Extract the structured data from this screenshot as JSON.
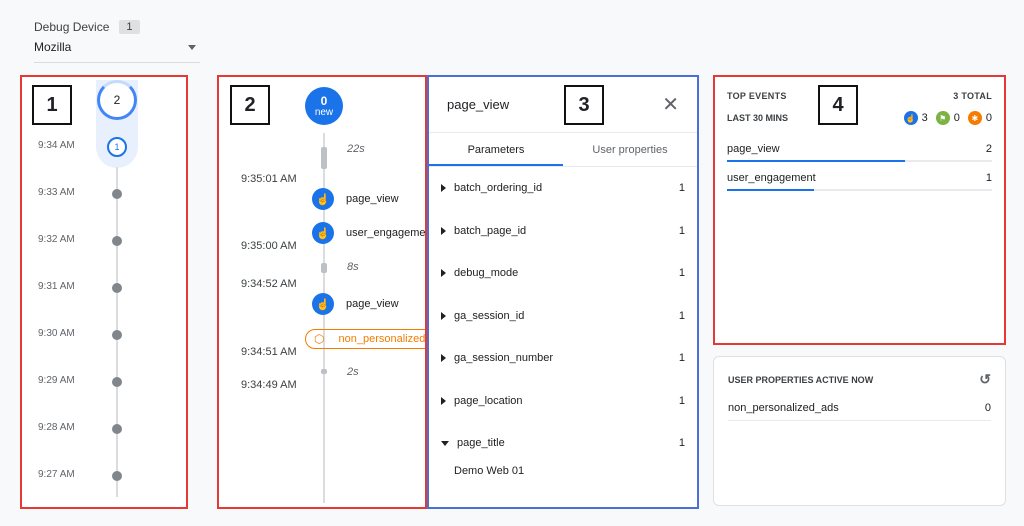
{
  "debug_device": {
    "label": "Debug Device",
    "count": "1",
    "selected": "Mozilla"
  },
  "badges": {
    "b1": "1",
    "b2": "2",
    "b3": "3",
    "b4": "4"
  },
  "minutes_panel": {
    "top_count": "2",
    "current_count": "1",
    "times": [
      "9:34 AM",
      "9:33 AM",
      "9:32 AM",
      "9:31 AM",
      "9:30 AM",
      "9:29 AM",
      "9:28 AM",
      "9:27 AM"
    ]
  },
  "seconds_panel": {
    "new_count": "0",
    "new_label": "new",
    "gaps": [
      "22s",
      "8s",
      "2s"
    ],
    "times": [
      "9:35:01 AM",
      "9:35:00 AM",
      "9:34:52 AM",
      "9:34:51 AM",
      "9:34:49 AM"
    ],
    "events": [
      "page_view",
      "user_engagement",
      "page_view"
    ],
    "conversion_event": "non_personalized_ads"
  },
  "event_panel": {
    "title": "page_view",
    "close_icon": "✕",
    "tabs": [
      "Parameters",
      "User properties"
    ],
    "params": [
      {
        "name": "batch_ordering_id",
        "value": "1"
      },
      {
        "name": "batch_page_id",
        "value": "1"
      },
      {
        "name": "debug_mode",
        "value": "1"
      },
      {
        "name": "ga_session_id",
        "value": "1"
      },
      {
        "name": "ga_session_number",
        "value": "1"
      },
      {
        "name": "page_location",
        "value": "1"
      },
      {
        "name": "page_title",
        "value": "1"
      }
    ],
    "expanded_value": "Demo Web 01"
  },
  "top_events": {
    "title": "TOP EVENTS",
    "total": "3 TOTAL",
    "period": "LAST 30 MINS",
    "counts": {
      "events": "3",
      "conversions": "0",
      "errors": "0"
    },
    "items": [
      {
        "name": "page_view",
        "count": "2",
        "share": 0.67
      },
      {
        "name": "user_engagement",
        "count": "1",
        "share": 0.33
      }
    ],
    "colors": {
      "events": "#1a73e8",
      "conversions": "#7cb342",
      "errors": "#f57c00"
    }
  },
  "user_properties": {
    "title": "USER PROPERTIES ACTIVE NOW",
    "history_icon": "history-icon",
    "items": [
      {
        "name": "non_personalized_ads",
        "value": "0"
      }
    ]
  }
}
